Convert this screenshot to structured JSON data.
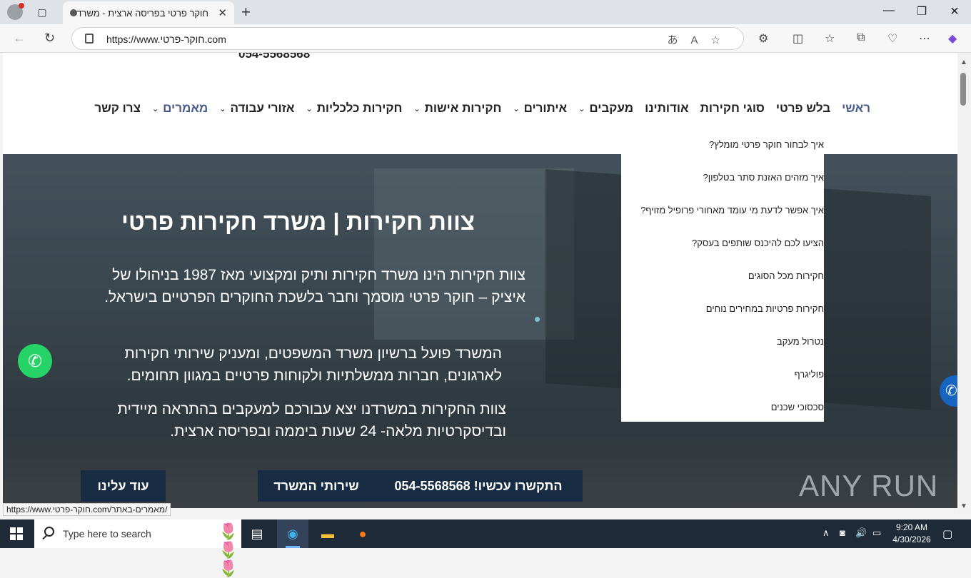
{
  "browser": {
    "tab_title": "חוקר פרטי בפריסה ארצית - משרד",
    "url": "https://www.חוקר-פרטי.com",
    "status_url": "https://www.חוקר-פרטי.com/מאמרים-באתר/"
  },
  "header": {
    "phone": "054-5568568"
  },
  "menu": [
    {
      "label": "צרו קשר",
      "dropdown": false
    },
    {
      "label": "מאמרים",
      "dropdown": true,
      "active": true
    },
    {
      "label": "אזורי עבודה",
      "dropdown": true
    },
    {
      "label": "חקירות כלכליות",
      "dropdown": true
    },
    {
      "label": "חקירות אישות",
      "dropdown": true
    },
    {
      "label": "איתורים",
      "dropdown": true
    },
    {
      "label": "מעקבים",
      "dropdown": true
    },
    {
      "label": "אודותינו",
      "dropdown": false
    },
    {
      "label": "סוגי חקירות",
      "dropdown": false
    },
    {
      "label": "בלש פרטי",
      "dropdown": false
    },
    {
      "label": "ראשי",
      "dropdown": false,
      "home": true
    }
  ],
  "dropdown": [
    "איך לבחור חוקר פרטי מומלץ?",
    "איך מזהים האזנת סתר בטלפון?",
    "איך אפשר לדעת מי עומד מאחורי פרופיל מזויף?",
    "הציעו לכם להיכנס שותפים בעסק?",
    "חקירות מכל הסוגים",
    "חקירות פרטיות במחירים נוחים",
    "נטרול מעקב",
    "פוליגרף",
    "סכסוכי שכנים"
  ],
  "hero": {
    "title": "צוות חקירות | משרד חקירות פרטי",
    "p1": "צוות חקירות הינו משרד חקירות ותיק ומקצועי מאז 1987 בניהולו של איציק – חוקר פרטי מוסמך וחבר בלשכת החוקרים הפרטיים בישראל.",
    "p2": "המשרד פועל ברשיון משרד המשפטים, ומעניק שירותי חקירות לארגונים, חברות ממשלתיות ולקוחות פרטיים במגוון תחומים.",
    "p3": "צוות החקירות במשרדנו יצא עבורכם למעקבים בהתראה מיידית ובדיסקרטיות מלאה- 24 שעות ביממה ובפריסה ארצית.",
    "btn_call": "התקשרו עכשיו! 054-5568568",
    "btn_services": "שירותי המשרד",
    "btn_about": "עוד עלינו"
  },
  "watermark": "ANY RUN",
  "taskbar": {
    "search_placeholder": "Type here to search",
    "time": "9:20 AM",
    "date": "4/30/2026"
  }
}
